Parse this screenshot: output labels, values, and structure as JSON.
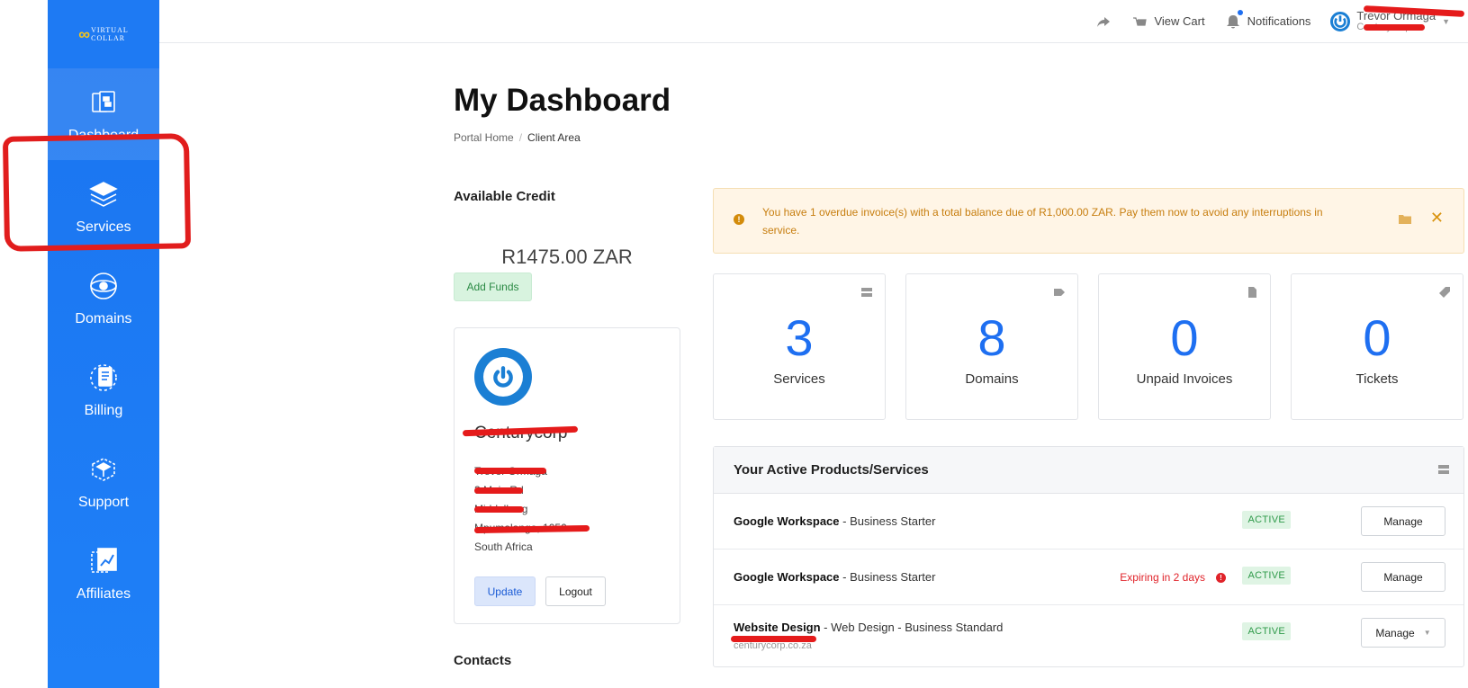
{
  "brand": {
    "name_line1": "VIRTUAL",
    "name_line2": "COLLAR"
  },
  "sidebar": {
    "items": [
      {
        "label": "Dashboard",
        "icon": "dashboard-icon"
      },
      {
        "label": "Services",
        "icon": "services-icon"
      },
      {
        "label": "Domains",
        "icon": "domains-icon"
      },
      {
        "label": "Billing",
        "icon": "billing-icon"
      },
      {
        "label": "Support",
        "icon": "support-icon"
      },
      {
        "label": "Affiliates",
        "icon": "affiliates-icon"
      }
    ]
  },
  "topbar": {
    "share_icon": "share-icon",
    "view_cart": "View Cart",
    "notifications": "Notifications",
    "user_name": "Trevor Ormaga",
    "user_sub": "Centurycorp"
  },
  "page": {
    "title": "My Dashboard",
    "breadcrumb": {
      "home": "Portal Home",
      "separator": "/",
      "current": "Client Area"
    }
  },
  "credit": {
    "title": "Available Credit",
    "amount": "R1475.00 ZAR",
    "add_funds": "Add Funds"
  },
  "profile": {
    "company": "Centurycorp",
    "address_lines": [
      "Trevor Ormaga",
      "3 Main Rd",
      "Middelburg",
      "Mpumalanga, 1050",
      "South Africa"
    ],
    "update": "Update",
    "logout": "Logout"
  },
  "contacts": {
    "title": "Contacts"
  },
  "alert": {
    "text": "You have 1 overdue invoice(s) with a total balance due of R1,000.00 ZAR. Pay them now to avoid any interruptions in service.",
    "close": "✕"
  },
  "stats": [
    {
      "value": "3",
      "label": "Services",
      "icon": "server-icon"
    },
    {
      "value": "8",
      "label": "Domains",
      "icon": "tag-icon"
    },
    {
      "value": "0",
      "label": "Unpaid Invoices",
      "icon": "document-icon"
    },
    {
      "value": "0",
      "label": "Tickets",
      "icon": "ticket-icon"
    }
  ],
  "products": {
    "title": "Your Active Products/Services",
    "rows": [
      {
        "name": "Google Workspace",
        "detail": " - Business Starter",
        "sub": "",
        "status": "ACTIVE",
        "action": "Manage",
        "expiring": ""
      },
      {
        "name": "Google Workspace",
        "detail": " - Business Starter",
        "sub": "",
        "status": "ACTIVE",
        "action": "Manage",
        "expiring": "Expiring in 2 days"
      },
      {
        "name": "Website Design",
        "detail": " - Web Design - Business Standard",
        "sub": "centurycorp.co.za",
        "status": "ACTIVE",
        "action": "Manage",
        "expiring": ""
      }
    ]
  },
  "colors": {
    "sidebar": "#1a74f0",
    "accent": "#1e6ff1",
    "annotation": "#e51b1b",
    "active_badge": "#2f9a4a",
    "warning": "#c77e0f"
  }
}
